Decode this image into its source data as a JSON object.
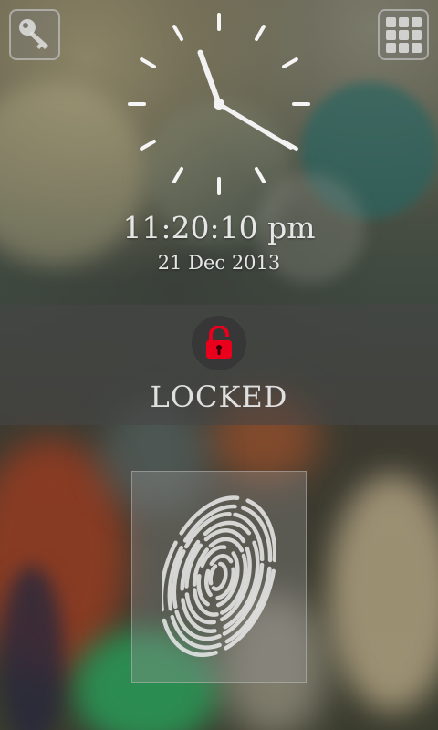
{
  "clock": {
    "time": "11:20:10 pm",
    "date": "21 Dec 2013",
    "hour": 11,
    "minute": 20,
    "second": 10
  },
  "lock": {
    "status": "LOCKED",
    "icon": "padlock-icon",
    "icon_color": "#e8001c"
  },
  "top_bar": {
    "left_icon": "key-icon",
    "right_icon": "grid-icon"
  },
  "scanner": {
    "icon": "fingerprint-icon"
  }
}
